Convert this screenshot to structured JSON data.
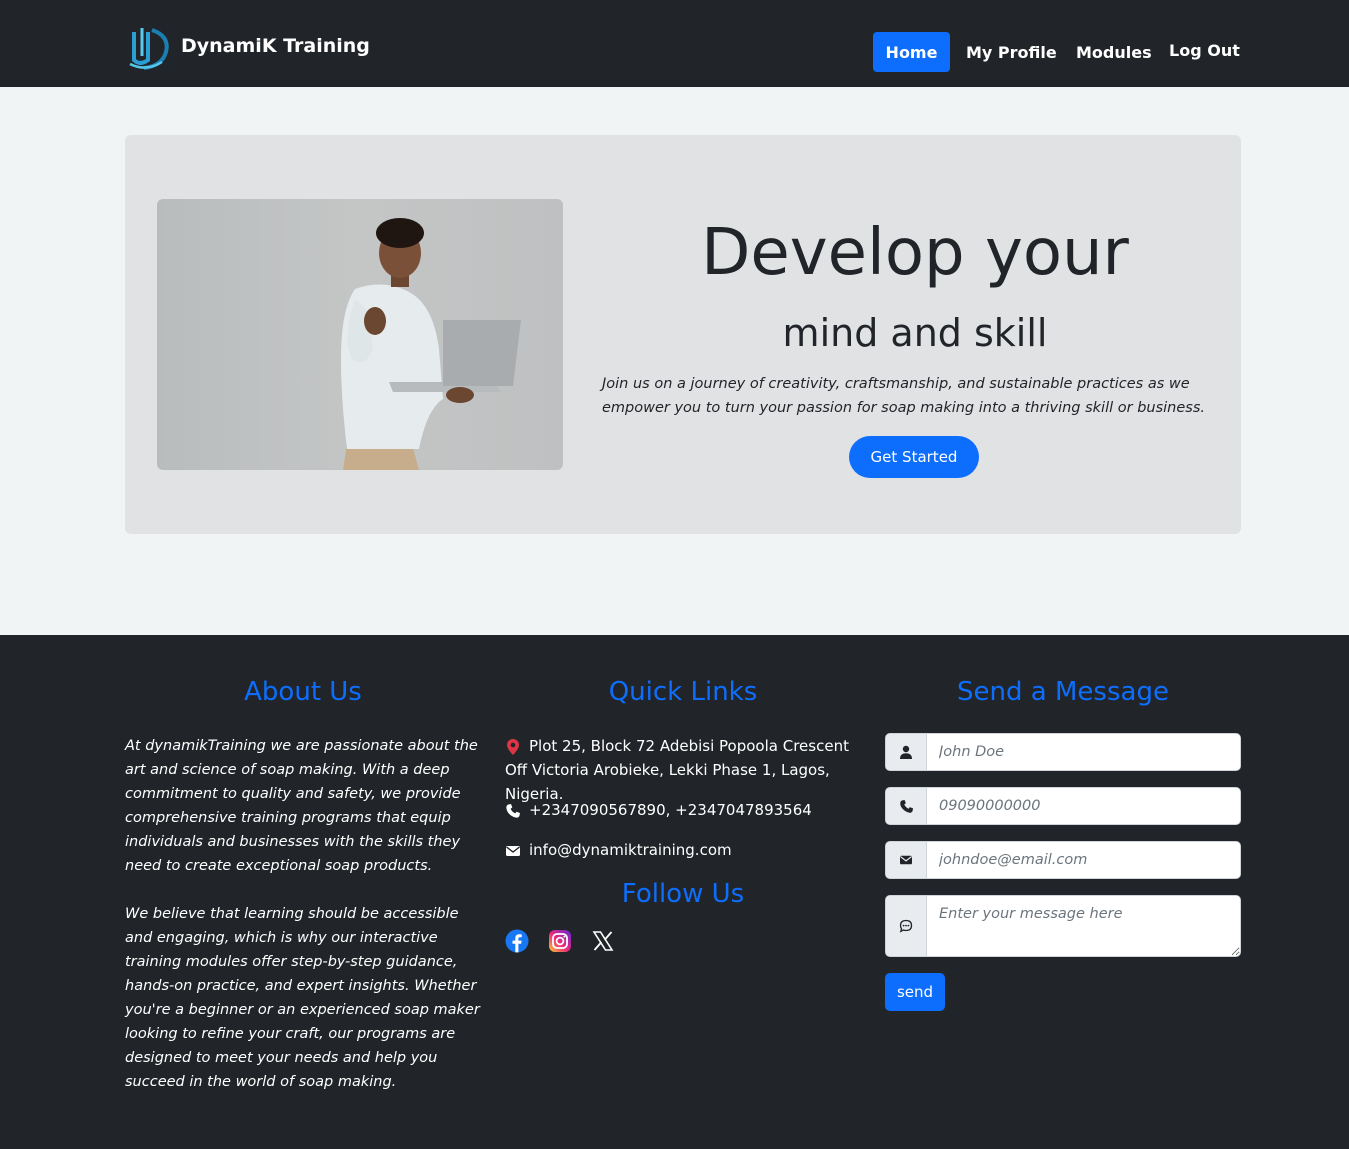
{
  "nav": {
    "brand": "DynamiK Training",
    "links": [
      {
        "label": "Home",
        "active": true
      },
      {
        "label": "My Profile"
      },
      {
        "label": "Modules"
      },
      {
        "label": "Log Out"
      }
    ]
  },
  "hero": {
    "title": "Develop your",
    "subtitle": "mind and skill",
    "text": "Join us on a journey of creativity, craftsmanship, and sustainable practices as we empower you to turn your passion for soap making into a thriving skill or business.",
    "cta": "Get Started"
  },
  "footer": {
    "about": {
      "title": "About Us",
      "p1": "At dynamikTraining we are passionate about the art and science of soap making. With a deep commitment to quality and safety, we provide comprehensive training programs that equip individuals and businesses with the skills they need to create exceptional soap products.",
      "p2": "We believe that learning should be accessible and engaging, which is why our interactive training modules offer step-by-step guidance, hands-on practice, and expert insights. Whether you're a beginner or an experienced soap maker looking to refine your craft, our programs are designed to meet your needs and help you succeed in the world of soap making."
    },
    "quick_links": {
      "title": "Quick Links",
      "address": "Plot 25, Block 72 Adebisi Popoola Crescent Off Victoria Arobieke, Lekki Phase 1, Lagos, Nigeria.",
      "phone": "+2347090567890, +2347047893564",
      "email": "info@dynamiktraining.com"
    },
    "follow": {
      "title": "Follow Us",
      "icons": [
        "facebook-icon",
        "instagram-icon",
        "x-icon"
      ]
    },
    "message": {
      "title": "Send a Message",
      "name_placeholder": "John Doe",
      "phone_placeholder": "09090000000",
      "email_placeholder": "johndoe@email.com",
      "message_placeholder": "Enter your message here",
      "send_label": "send"
    }
  },
  "colors": {
    "primary": "#0d6efd",
    "dark": "#212529",
    "page_bg": "#f1f4f5",
    "hero_bg": "#e1e2e4"
  }
}
